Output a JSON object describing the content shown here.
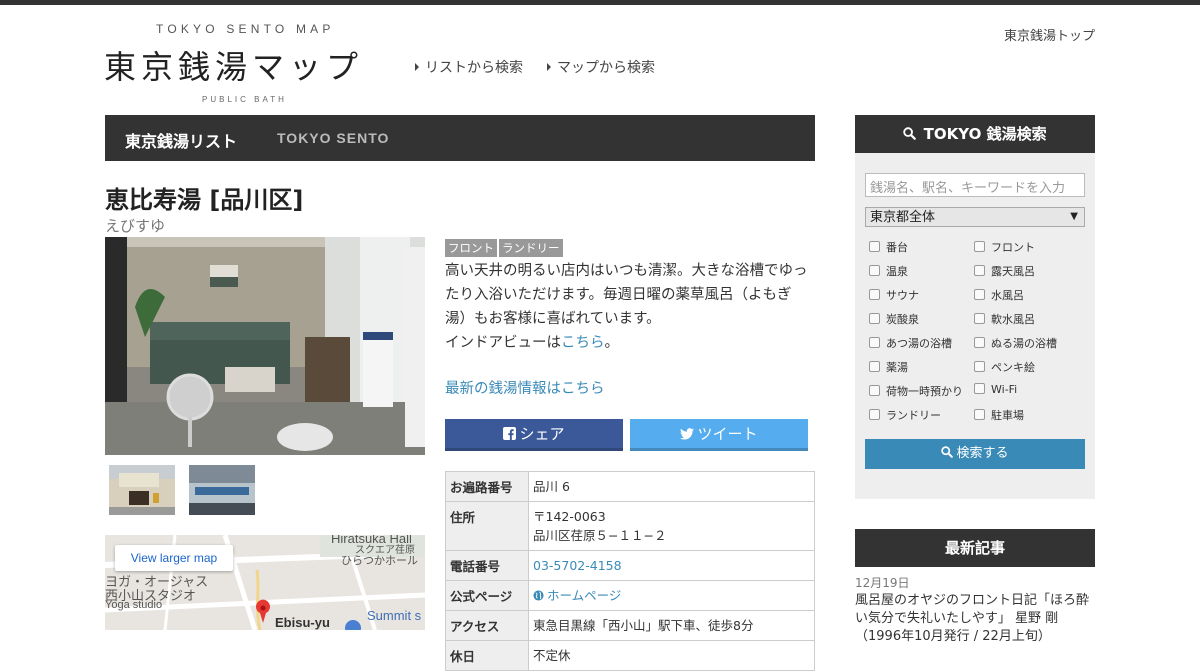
{
  "header": {
    "title_en": "TOKYO SENTO MAP",
    "logo": "東京銭湯マップ",
    "subtitle": "PUBLIC BATH",
    "nav": [
      {
        "label": "リストから検索"
      },
      {
        "label": "マップから検索"
      }
    ],
    "top_link": "東京銭湯トップ"
  },
  "navbar": {
    "main": "東京銭湯リスト",
    "sub": "TOKYO SENTO"
  },
  "sento": {
    "name": "恵比寿湯 [品川区]",
    "kana": "えびすゆ",
    "tags": [
      "フロント",
      "ランドリー"
    ],
    "desc1": "高い天井の明るい店内はいつも清潔。大きな浴槽でゆったり入浴いただけます。毎週日曜の薬草風呂（よもぎ湯）もお客様に喜ばれています。",
    "desc2_prefix": "インドアビューは",
    "desc2_link": "こちら",
    "desc2_suffix": "。",
    "news_link": "最新の銭湯情報はこちら"
  },
  "share": {
    "facebook": "シェア",
    "twitter": "ツイート"
  },
  "map": {
    "button": "View larger map",
    "labels": {
      "hiratsuka": "Hiratsuka Hall",
      "hiratsuka_jp1": "スクエア荏原",
      "hiratsuka_jp2": "ひらつかホール",
      "yoga_jp1": "ヨガ・オージャス",
      "yoga_jp2": "西小山スタジオ",
      "yoga_en": "Yoga studio",
      "ebisu": "Ebisu-yu",
      "summit": "Summit s"
    }
  },
  "info": {
    "rows": [
      {
        "label": "お遍路番号",
        "value": "品川 6"
      },
      {
        "label": "住所",
        "value": "〒142-0063",
        "value2": "品川区荏原５−１１−２"
      },
      {
        "label": "電話番号",
        "value": "03-5702-4158"
      },
      {
        "label": "公式ページ",
        "value": "ホームページ"
      },
      {
        "label": "アクセス",
        "value": "東急目黒線「西小山」駅下車、徒歩8分"
      },
      {
        "label": "休日",
        "value": "不定休"
      }
    ]
  },
  "sidebar": {
    "search_title": "TOKYO 銭湯検索",
    "search_placeholder": "銭湯名、駅名、キーワードを入力",
    "area": "東京都全体",
    "checks": [
      "番台",
      "フロント",
      "温泉",
      "露天風呂",
      "サウナ",
      "水風呂",
      "炭酸泉",
      "軟水風呂",
      "あつ湯の浴槽",
      "ぬる湯の浴槽",
      "薬湯",
      "ペンキ絵",
      "荷物一時預かり",
      "Wi-Fi",
      "ランドリー",
      "駐車場"
    ],
    "search_button": "検索する",
    "news_title": "最新記事",
    "news_date": "12月19日",
    "news_item": "風呂屋のオヤジのフロント日記「ほろ酔い気分で失礼いたしやす」 星野 剛 （1996年10月発行 / 22月上旬）"
  },
  "colors": {
    "dark": "#333333",
    "link": "#3a8ab8",
    "facebook": "#3b5998",
    "twitter": "#55acee"
  }
}
